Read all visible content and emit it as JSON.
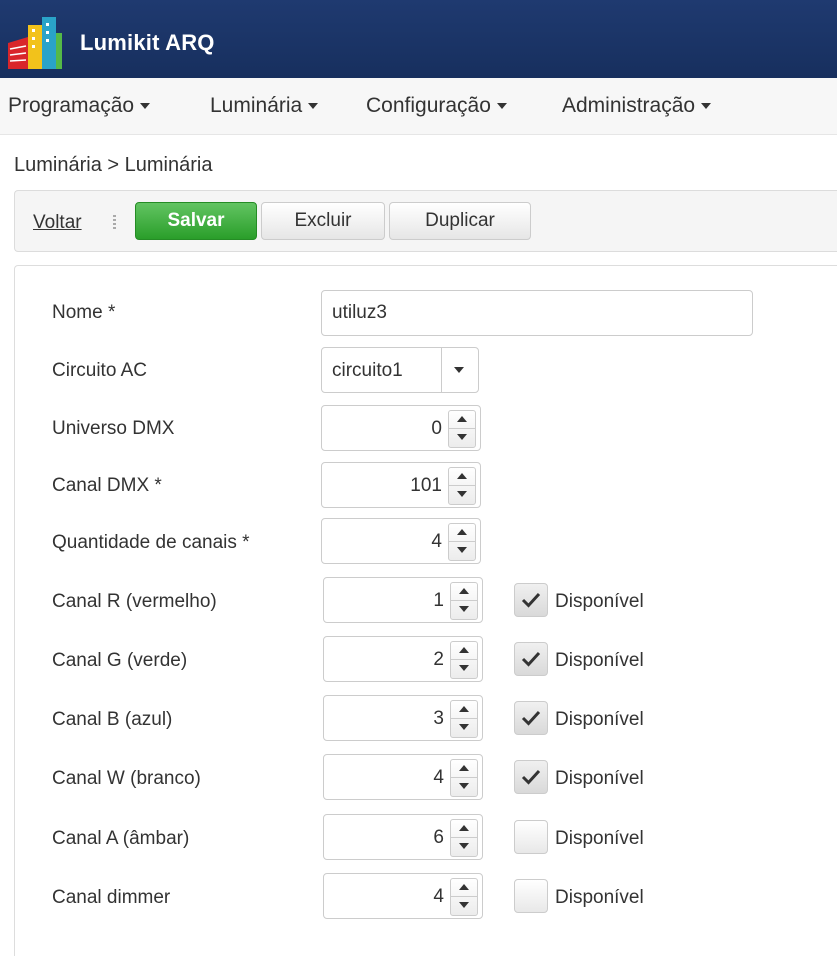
{
  "header": {
    "title": "Lumikit ARQ",
    "background": "#1f3a70"
  },
  "menu": {
    "items": [
      {
        "label": "Programação"
      },
      {
        "label": "Luminária"
      },
      {
        "label": "Configuração"
      },
      {
        "label": "Administração"
      }
    ]
  },
  "breadcrumb": {
    "text": "Luminária > Luminária"
  },
  "toolbar": {
    "back_label": "Voltar",
    "save_label": "Salvar",
    "delete_label": "Excluir",
    "duplicate_label": "Duplicar"
  },
  "form": {
    "nome": {
      "label": "Nome *",
      "value": "utiluz3"
    },
    "circuito": {
      "label": "Circuito AC",
      "value": "circuito1"
    },
    "universo": {
      "label": "Universo DMX",
      "value": "0"
    },
    "canal_dmx": {
      "label": "Canal DMX *",
      "value": "101"
    },
    "quantidade": {
      "label": "Quantidade de canais *",
      "value": "4"
    },
    "channels": [
      {
        "label": "Canal R (vermelho)",
        "value": "1",
        "available_label": "Disponível",
        "available": true
      },
      {
        "label": "Canal G (verde)",
        "value": "2",
        "available_label": "Disponível",
        "available": true
      },
      {
        "label": "Canal B (azul)",
        "value": "3",
        "available_label": "Disponível",
        "available": true
      },
      {
        "label": "Canal W (branco)",
        "value": "4",
        "available_label": "Disponível",
        "available": true
      },
      {
        "label": "Canal A (âmbar)",
        "value": "6",
        "available_label": "Disponível",
        "available": false
      },
      {
        "label": "Canal dimmer",
        "value": "4",
        "available_label": "Disponível",
        "available": false
      }
    ]
  },
  "colors": {
    "save_button": "#2a9e2a",
    "header": "#1f3a70"
  }
}
